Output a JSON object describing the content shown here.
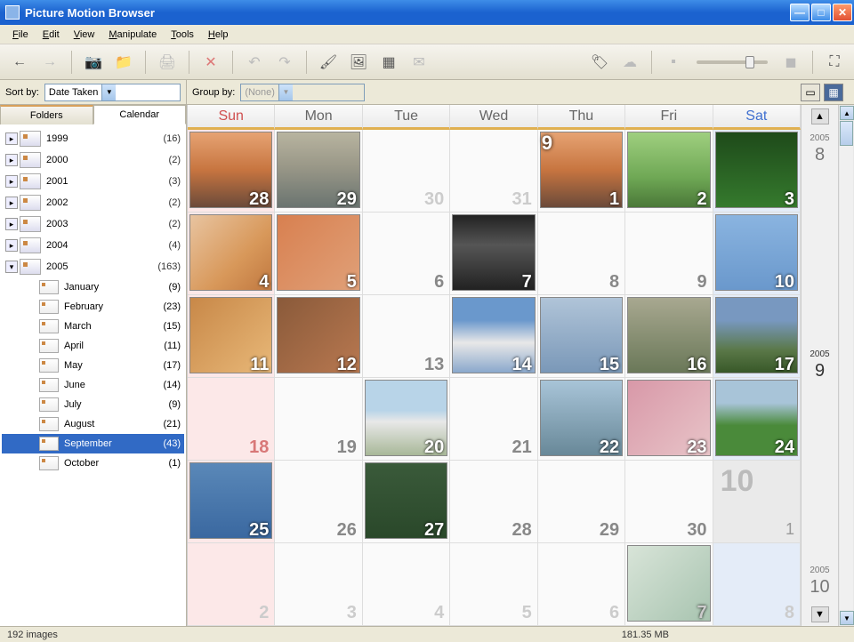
{
  "window": {
    "title": "Picture Motion Browser"
  },
  "menu": {
    "file": "File",
    "edit": "Edit",
    "view": "View",
    "manipulate": "Manipulate",
    "tools": "Tools",
    "help": "Help"
  },
  "sortbar": {
    "sort_label": "Sort by:",
    "sort_value": "Date Taken",
    "group_label": "Group by:",
    "group_value": "(None)"
  },
  "sidebar": {
    "folders_tab": "Folders",
    "calendar_tab": "Calendar",
    "years": [
      {
        "name": "1999",
        "count": "(16)",
        "expanded": false
      },
      {
        "name": "2000",
        "count": "(2)",
        "expanded": false
      },
      {
        "name": "2001",
        "count": "(3)",
        "expanded": false
      },
      {
        "name": "2002",
        "count": "(2)",
        "expanded": false
      },
      {
        "name": "2003",
        "count": "(2)",
        "expanded": false
      },
      {
        "name": "2004",
        "count": "(4)",
        "expanded": false
      },
      {
        "name": "2005",
        "count": "(163)",
        "expanded": true
      }
    ],
    "months": [
      {
        "name": "January",
        "count": "(9)",
        "selected": false
      },
      {
        "name": "February",
        "count": "(23)",
        "selected": false
      },
      {
        "name": "March",
        "count": "(15)",
        "selected": false
      },
      {
        "name": "April",
        "count": "(11)",
        "selected": false
      },
      {
        "name": "May",
        "count": "(17)",
        "selected": false
      },
      {
        "name": "June",
        "count": "(14)",
        "selected": false
      },
      {
        "name": "July",
        "count": "(9)",
        "selected": false
      },
      {
        "name": "August",
        "count": "(21)",
        "selected": false
      },
      {
        "name": "September",
        "count": "(43)",
        "selected": true
      },
      {
        "name": "October",
        "count": "(1)",
        "selected": false
      }
    ]
  },
  "calendar": {
    "dayheads": {
      "sun": "Sun",
      "mon": "Mon",
      "tue": "Tue",
      "wed": "Wed",
      "thu": "Thu",
      "fri": "Fri",
      "sat": "Sat"
    },
    "cells": [
      {
        "d": "28",
        "cls": "sun hasimg",
        "img": "t-sunset"
      },
      {
        "d": "29",
        "cls": "hasimg",
        "img": "t-lake"
      },
      {
        "d": "30",
        "cls": "out"
      },
      {
        "d": "31",
        "cls": "out"
      },
      {
        "d": "1",
        "cls": "hasimg",
        "img": "t-sunset",
        "badge": "9"
      },
      {
        "d": "2",
        "cls": "hasimg",
        "img": "t-bird"
      },
      {
        "d": "3",
        "cls": "sat hasimg",
        "img": "t-forest2"
      },
      {
        "d": "4",
        "cls": "sun hasimg",
        "img": "t-shiba"
      },
      {
        "d": "5",
        "cls": "hasimg",
        "img": "t-dalm"
      },
      {
        "d": "6",
        "cls": ""
      },
      {
        "d": "7",
        "cls": "hasimg",
        "img": "t-cat"
      },
      {
        "d": "8",
        "cls": ""
      },
      {
        "d": "9",
        "cls": ""
      },
      {
        "d": "10",
        "cls": "sat hasimg",
        "img": "t-sky"
      },
      {
        "d": "11",
        "cls": "sun hasimg",
        "img": "t-retriever"
      },
      {
        "d": "12",
        "cls": "hasimg",
        "img": "t-dachs"
      },
      {
        "d": "13",
        "cls": ""
      },
      {
        "d": "14",
        "cls": "hasimg",
        "img": "t-swan"
      },
      {
        "d": "15",
        "cls": "hasimg",
        "img": "t-clouds"
      },
      {
        "d": "16",
        "cls": "hasimg",
        "img": "t-valley"
      },
      {
        "d": "17",
        "cls": "sat hasimg",
        "img": "t-mtn"
      },
      {
        "d": "18",
        "cls": "sun"
      },
      {
        "d": "19",
        "cls": ""
      },
      {
        "d": "20",
        "cls": "hasimg",
        "img": "t-gull"
      },
      {
        "d": "21",
        "cls": ""
      },
      {
        "d": "22",
        "cls": "hasimg",
        "img": "t-waterfall"
      },
      {
        "d": "23",
        "cls": "hasimg",
        "img": "t-blossom"
      },
      {
        "d": "24",
        "cls": "sat hasimg",
        "img": "t-field"
      },
      {
        "d": "25",
        "cls": "sun hasimg",
        "img": "t-seabird"
      },
      {
        "d": "26",
        "cls": ""
      },
      {
        "d": "27",
        "cls": "hasimg",
        "img": "t-pond"
      },
      {
        "d": "28",
        "cls": ""
      },
      {
        "d": "29",
        "cls": ""
      },
      {
        "d": "30",
        "cls": ""
      },
      {
        "d": "1",
        "cls": "sat next",
        "big": "10"
      },
      {
        "d": "2",
        "cls": "sun out"
      },
      {
        "d": "3",
        "cls": "out"
      },
      {
        "d": "4",
        "cls": "out"
      },
      {
        "d": "5",
        "cls": "out"
      },
      {
        "d": "6",
        "cls": "out"
      },
      {
        "d": "7",
        "cls": "out hasimg",
        "img": "t-bottle"
      },
      {
        "d": "8",
        "cls": "sat out"
      }
    ],
    "strip": {
      "prev": {
        "year": "2005",
        "month": "8"
      },
      "current": {
        "year": "2005",
        "month": "9"
      },
      "next": {
        "year": "2005",
        "month": "10"
      }
    }
  },
  "status": {
    "left": "192 images",
    "right": "181.35 MB"
  }
}
